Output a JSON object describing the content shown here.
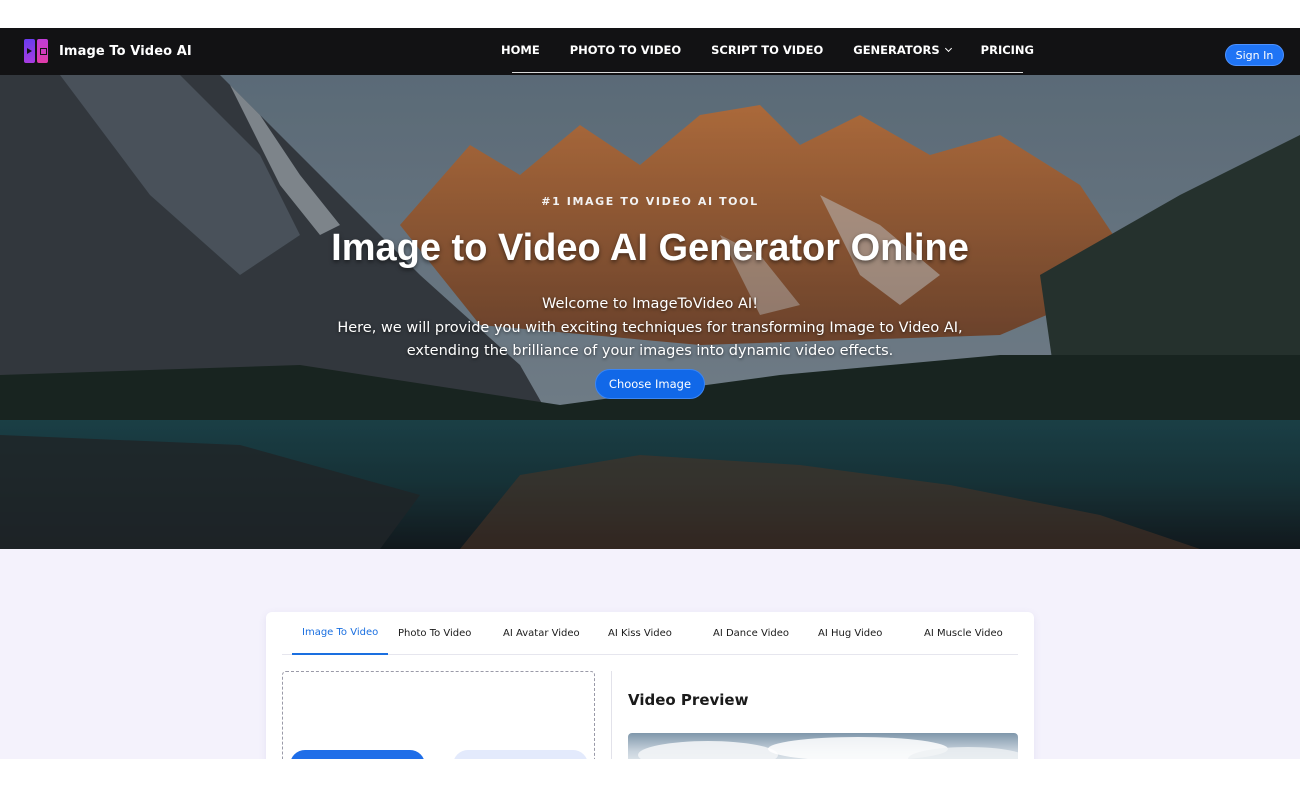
{
  "nav": {
    "brand": "Image To Video AI",
    "items": [
      {
        "label": "HOME"
      },
      {
        "label": "PHOTO TO VIDEO"
      },
      {
        "label": "SCRIPT TO VIDEO"
      },
      {
        "label": "GENERATORS"
      },
      {
        "label": "PRICING"
      }
    ],
    "signin_label": "Sign In"
  },
  "hero": {
    "eyebrow": "#1 IMAGE TO VIDEO AI TOOL",
    "title": "Image to Video AI Generator Online",
    "desc_lines": [
      "Welcome to ImageToVideo AI!",
      "Here, we will provide you with exciting techniques for transforming Image to Video AI,",
      "extending the brilliance of your images into dynamic video effects."
    ],
    "cta_label": "Choose Image"
  },
  "tool": {
    "tabs": [
      {
        "label": "Image To Video",
        "active": true
      },
      {
        "label": "Photo To Video"
      },
      {
        "label": "AI Avatar Video"
      },
      {
        "label": "AI Kiss Video"
      },
      {
        "label": "AI Dance Video"
      },
      {
        "label": "AI Hug Video"
      },
      {
        "label": "AI Muscle Video"
      }
    ],
    "preview_title": "Video Preview"
  },
  "colors": {
    "nav_bg": "#121214",
    "accent": "#1168e8",
    "active_tab": "#1a6fe0",
    "section_bg": "#f4f2fc"
  },
  "icons": {
    "logo": "film-frames-icon",
    "dropdown": "chevron-down-icon"
  }
}
